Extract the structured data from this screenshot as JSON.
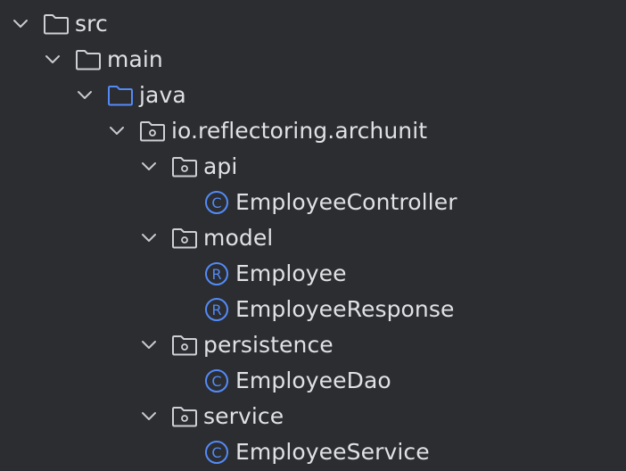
{
  "theme": {
    "background": "#2b2d30",
    "text": "#dfe1e5",
    "chevron": "#c8cacf",
    "folder": "#ced0d6",
    "source_folder": "#548af7",
    "class_icon": "#548af7"
  },
  "tree": {
    "nodes": [
      {
        "label": "src",
        "icon": "folder-icon",
        "expanded": true
      },
      {
        "label": "main",
        "icon": "folder-icon",
        "expanded": true
      },
      {
        "label": "java",
        "icon": "source-folder-icon",
        "expanded": true
      },
      {
        "label": "io.reflectoring.archunit",
        "icon": "package-icon",
        "expanded": true
      },
      {
        "label": "api",
        "icon": "package-icon",
        "expanded": true
      },
      {
        "label": "EmployeeController",
        "icon": "class-icon",
        "badge": "C"
      },
      {
        "label": "model",
        "icon": "package-icon",
        "expanded": true
      },
      {
        "label": "Employee",
        "icon": "record-icon",
        "badge": "R"
      },
      {
        "label": "EmployeeResponse",
        "icon": "record-icon",
        "badge": "R"
      },
      {
        "label": "persistence",
        "icon": "package-icon",
        "expanded": true
      },
      {
        "label": "EmployeeDao",
        "icon": "class-icon",
        "badge": "C"
      },
      {
        "label": "service",
        "icon": "package-icon",
        "expanded": true
      },
      {
        "label": "EmployeeService",
        "icon": "class-icon",
        "badge": "C"
      }
    ]
  }
}
